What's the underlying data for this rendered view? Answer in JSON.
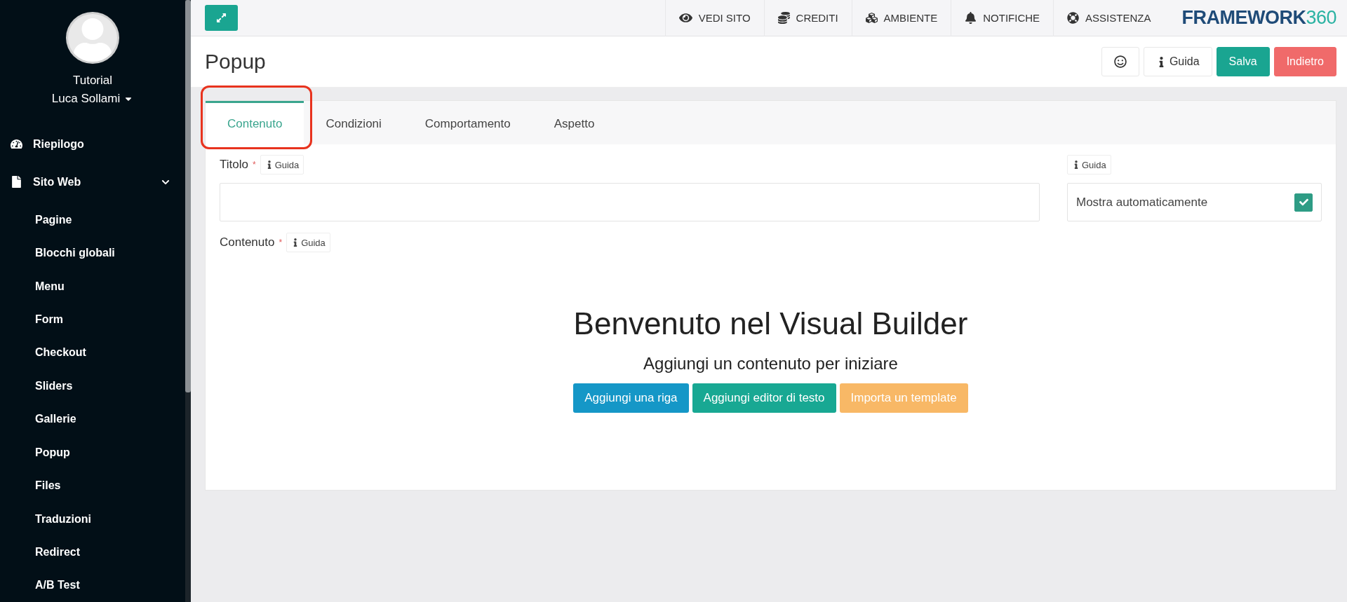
{
  "sidebar": {
    "user": {
      "line1": "Tutorial",
      "line2": "Luca Sollami"
    },
    "items": [
      {
        "label": "Riepilogo",
        "selected": false
      },
      {
        "label": "Sito Web",
        "selected": false,
        "expanded": true,
        "children": [
          {
            "label": "Pagine",
            "selected": false
          },
          {
            "label": "Blocchi globali",
            "selected": false
          },
          {
            "label": "Menu",
            "selected": false
          },
          {
            "label": "Form",
            "selected": false
          },
          {
            "label": "Checkout",
            "selected": false
          },
          {
            "label": "Sliders",
            "selected": false
          },
          {
            "label": "Gallerie",
            "selected": false
          },
          {
            "label": "Popup",
            "selected": false
          },
          {
            "label": "Files",
            "selected": false
          },
          {
            "label": "Traduzioni",
            "selected": false
          },
          {
            "label": "Redirect",
            "selected": false
          },
          {
            "label": "A/B Test",
            "selected": false
          }
        ]
      }
    ]
  },
  "topbar": {
    "nav": [
      "VEDI SITO",
      "CREDITI",
      "AMBIENTE",
      "NOTIFICHE",
      "ASSISTENZA"
    ],
    "logo": {
      "text": "FRAMEWORK",
      "accent": "360"
    }
  },
  "header": {
    "title": "Popup",
    "buttons": [
      {
        "kind": "icon"
      },
      {
        "kind": "help",
        "label": "Guida"
      },
      {
        "kind": "primary",
        "label": "Salva"
      },
      {
        "kind": "danger",
        "label": "Indietro"
      }
    ]
  },
  "tabs": [
    {
      "label": "Contenuto",
      "selected": true,
      "highlighted": true
    },
    {
      "label": "Condizioni",
      "selected": false,
      "highlighted": false
    },
    {
      "label": "Comportamento",
      "selected": false,
      "highlighted": false
    },
    {
      "label": "Aspetto",
      "selected": false,
      "highlighted": false
    }
  ],
  "form": {
    "title_field": {
      "label": "Titolo",
      "required_mark": "*",
      "help": "Guida"
    },
    "auto_show": {
      "help": "Guida",
      "label": "Mostra automaticamente",
      "checked": true
    },
    "content_field": {
      "label": "Contenuto",
      "required_mark": "*",
      "help": "Guida"
    }
  },
  "builder": {
    "heading": "Benvenuto nel Visual Builder",
    "subheading": "Aggiungi un contenuto per iniziare",
    "buttons": [
      {
        "label": "Aggiungi una riga",
        "kind": "info"
      },
      {
        "label": "Aggiungi editor di testo",
        "kind": "primary"
      },
      {
        "label": "Importa un template",
        "kind": "warning"
      }
    ]
  }
}
